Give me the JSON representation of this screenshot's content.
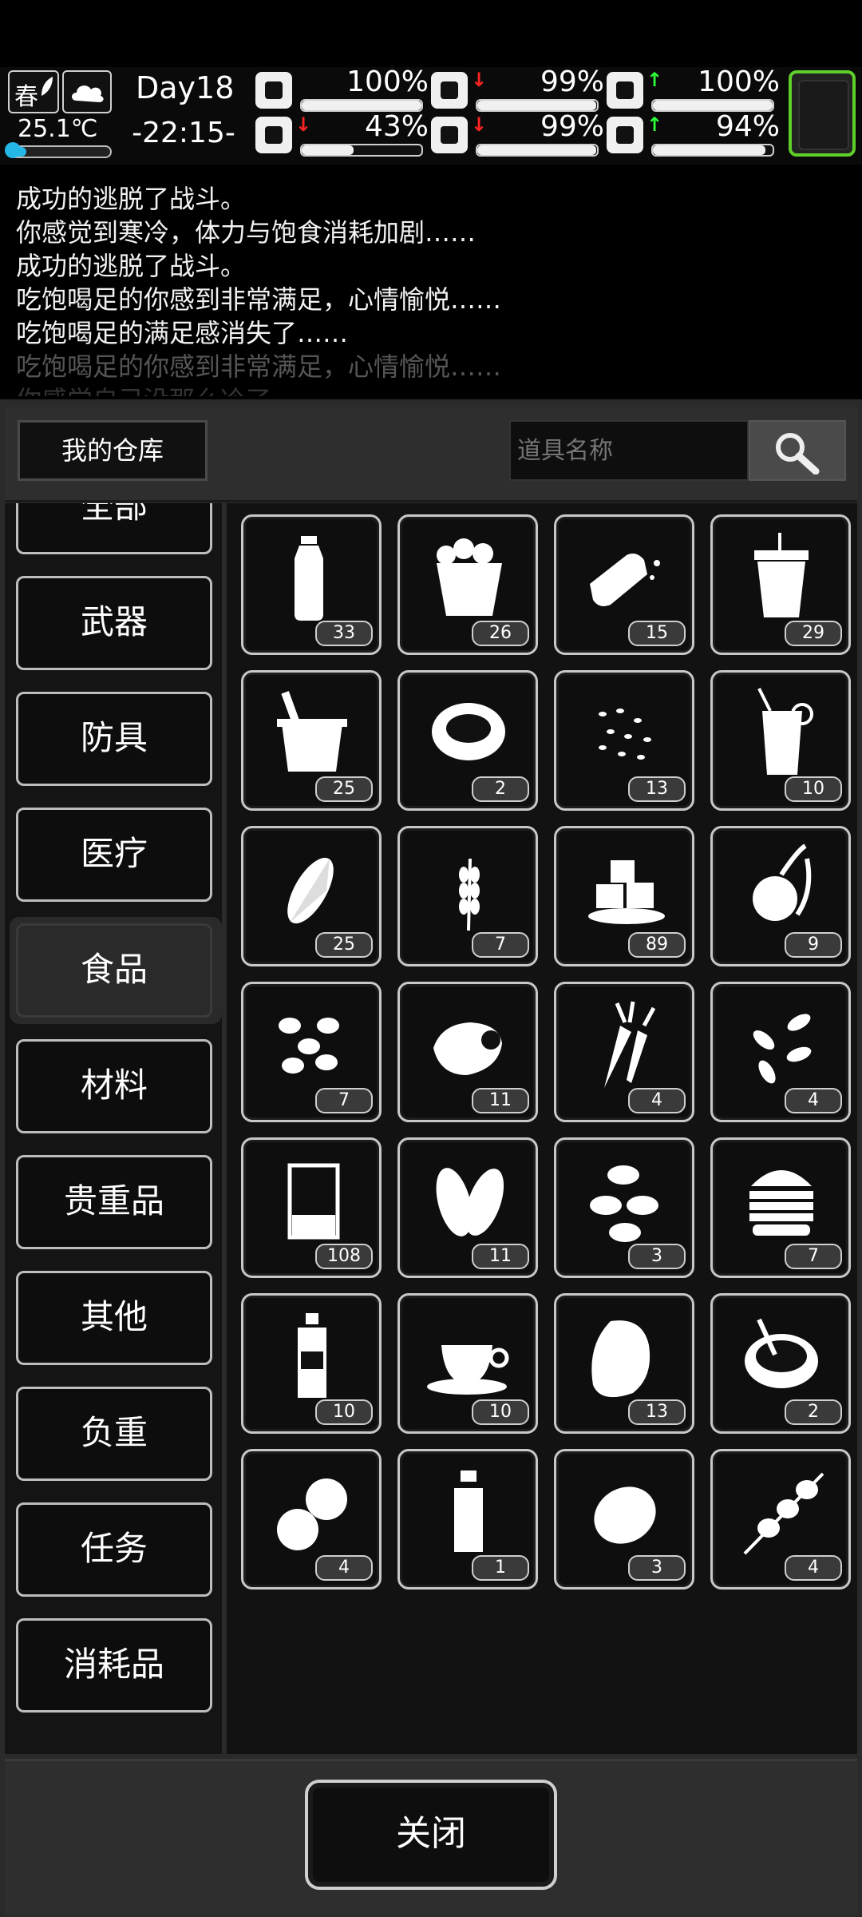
{
  "hud": {
    "season": "春",
    "temperature": "25.1℃",
    "temperature_level": 0.15,
    "day": "Day18",
    "time": "-22:15-",
    "stats": [
      {
        "icon": "medkit-icon",
        "value": "100%",
        "level": 1.0,
        "trend": ""
      },
      {
        "icon": "stomach-icon",
        "value": "99%",
        "level": 0.99,
        "trend": "down"
      },
      {
        "icon": "mood-icon",
        "value": "100%",
        "level": 1.0,
        "trend": "up"
      },
      {
        "icon": "leg-icon",
        "value": "43%",
        "level": 0.43,
        "trend": "down"
      },
      {
        "icon": "water-drop-icon",
        "value": "99%",
        "level": 0.99,
        "trend": "down"
      },
      {
        "icon": "heart-hand-icon",
        "value": "94%",
        "level": 0.94,
        "trend": "up"
      }
    ]
  },
  "log": [
    "成功的逃脱了战斗。",
    "你感觉到寒冷，体力与饱食消耗加剧……",
    "成功的逃脱了战斗。",
    "吃饱喝足的你感到非常满足，心情愉悦……",
    "吃饱喝足的满足感消失了……",
    "吃饱喝足的你感到非常满足，心情愉悦……",
    "你感觉自己没那么冷了"
  ],
  "warehouse": {
    "title": "我的仓库",
    "search_placeholder": "道具名称",
    "categories": [
      "全部",
      "武器",
      "防具",
      "医疗",
      "食品",
      "材料",
      "贵重品",
      "其他",
      "负重",
      "任务",
      "消耗品"
    ],
    "active_category": "食品",
    "items": [
      {
        "icon": "water-bottle-icon",
        "count": "33"
      },
      {
        "icon": "popcorn-icon",
        "count": "26"
      },
      {
        "icon": "bread-icon",
        "count": "15"
      },
      {
        "icon": "cola-cup-icon",
        "count": "29"
      },
      {
        "icon": "bucket-icon",
        "count": "25"
      },
      {
        "icon": "soup-pot-icon",
        "count": "2"
      },
      {
        "icon": "seeds-icon",
        "count": "13"
      },
      {
        "icon": "juice-glass-icon",
        "count": "10"
      },
      {
        "icon": "corn-icon",
        "count": "25"
      },
      {
        "icon": "wheat-icon",
        "count": "7"
      },
      {
        "icon": "sugar-cubes-icon",
        "count": "89"
      },
      {
        "icon": "vegetable-icon",
        "count": "9"
      },
      {
        "icon": "beans-icon",
        "count": "7"
      },
      {
        "icon": "meat-chunk-icon",
        "count": "11"
      },
      {
        "icon": "carrot-icon",
        "count": "4"
      },
      {
        "icon": "pumpkin-seeds-icon",
        "count": "4"
      },
      {
        "icon": "beaker-icon",
        "count": "108"
      },
      {
        "icon": "leaves-icon",
        "count": "11"
      },
      {
        "icon": "almonds-icon",
        "count": "3"
      },
      {
        "icon": "burger-icon",
        "count": "7"
      },
      {
        "icon": "sauce-bottle-icon",
        "count": "10"
      },
      {
        "icon": "coffee-cup-icon",
        "count": "10"
      },
      {
        "icon": "steak-icon",
        "count": "13"
      },
      {
        "icon": "stew-bowl-icon",
        "count": "2"
      },
      {
        "icon": "potatoes-icon",
        "count": "4"
      },
      {
        "icon": "spice-bottle-icon",
        "count": "1"
      },
      {
        "icon": "potato-icon",
        "count": "3"
      },
      {
        "icon": "skewer-icon",
        "count": "4"
      }
    ]
  },
  "footer": {
    "close_label": "关闭"
  },
  "colors": {
    "accent_green": "#5fcf2a",
    "temp_blue": "#25b7e6",
    "arrow_red": "#ff2424",
    "arrow_green": "#2cff3a"
  }
}
